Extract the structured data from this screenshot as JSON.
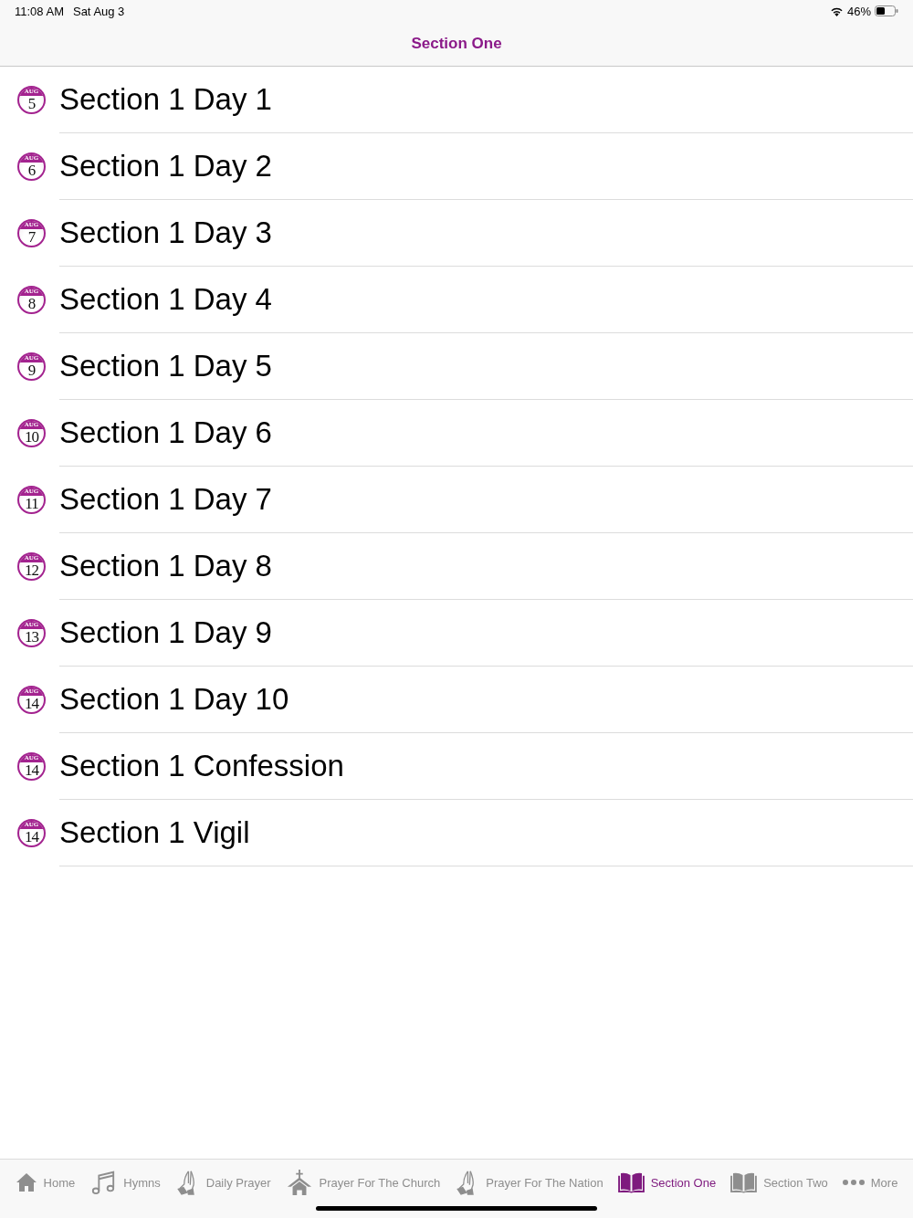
{
  "status_bar": {
    "time": "11:08 AM",
    "date": "Sat Aug 3",
    "battery": "46%"
  },
  "nav_bar": {
    "title": "Section One"
  },
  "rows": [
    {
      "label": "Section 1 Day 1",
      "badge_month": "AUG",
      "badge_day": "5"
    },
    {
      "label": "Section 1 Day 2",
      "badge_month": "AUG",
      "badge_day": "6"
    },
    {
      "label": "Section 1 Day 3",
      "badge_month": "AUG",
      "badge_day": "7"
    },
    {
      "label": "Section 1 Day 4",
      "badge_month": "AUG",
      "badge_day": "8"
    },
    {
      "label": "Section 1 Day 5",
      "badge_month": "AUG",
      "badge_day": "9"
    },
    {
      "label": "Section 1 Day 6",
      "badge_month": "AUG",
      "badge_day": "10"
    },
    {
      "label": "Section 1 Day 7",
      "badge_month": "AUG",
      "badge_day": "11"
    },
    {
      "label": "Section 1 Day 8",
      "badge_month": "AUG",
      "badge_day": "12"
    },
    {
      "label": "Section 1 Day 9",
      "badge_month": "AUG",
      "badge_day": "13"
    },
    {
      "label": "Section 1 Day 10",
      "badge_month": "AUG",
      "badge_day": "14"
    },
    {
      "label": "Section 1 Confession",
      "badge_month": "AUG",
      "badge_day": "14"
    },
    {
      "label": "Section 1 Vigil",
      "badge_month": "AUG",
      "badge_day": "14"
    }
  ],
  "tab_bar": {
    "tabs": [
      {
        "label": "Home",
        "kind": "home",
        "selected": false
      },
      {
        "label": "Hymns",
        "kind": "music",
        "selected": false
      },
      {
        "label": "Daily Prayer",
        "kind": "prayer",
        "selected": false
      },
      {
        "label": "Prayer For The Church",
        "kind": "church",
        "selected": false
      },
      {
        "label": "Prayer For The Nation",
        "kind": "prayer",
        "selected": false
      },
      {
        "label": "Section One",
        "kind": "book",
        "selected": true
      },
      {
        "label": "Section Two",
        "kind": "book",
        "selected": false
      },
      {
        "label": "More",
        "kind": "more",
        "selected": false
      }
    ]
  }
}
